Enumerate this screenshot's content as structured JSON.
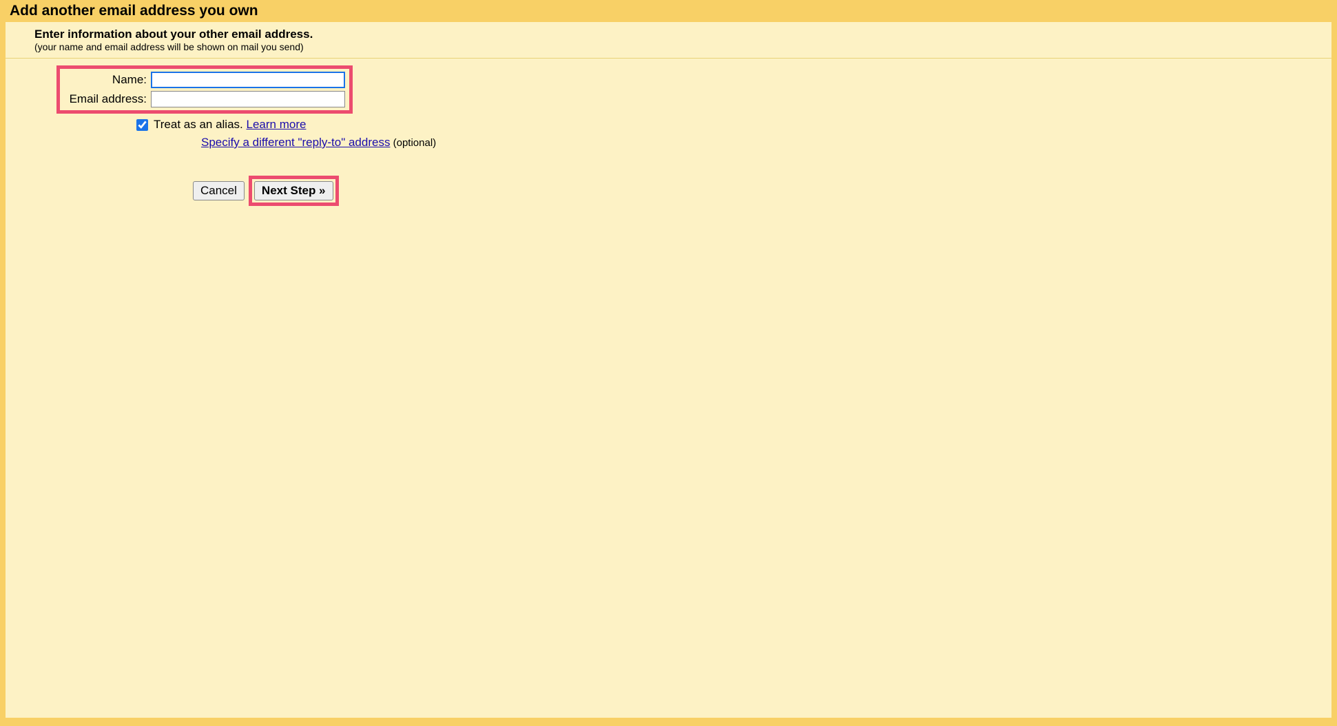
{
  "header": {
    "title": "Add another email address you own"
  },
  "instructions": {
    "primary": "Enter information about your other email address.",
    "secondary": "(your name and email address will be shown on mail you send)"
  },
  "form": {
    "name_label": "Name:",
    "name_value": "",
    "email_label": "Email address:",
    "email_value": "",
    "alias_checked": true,
    "alias_text": "Treat as an alias. ",
    "alias_learn_more": "Learn more",
    "replyto_link": "Specify a different \"reply-to\" address",
    "replyto_optional": " (optional)"
  },
  "buttons": {
    "cancel": "Cancel",
    "next": "Next Step »"
  }
}
